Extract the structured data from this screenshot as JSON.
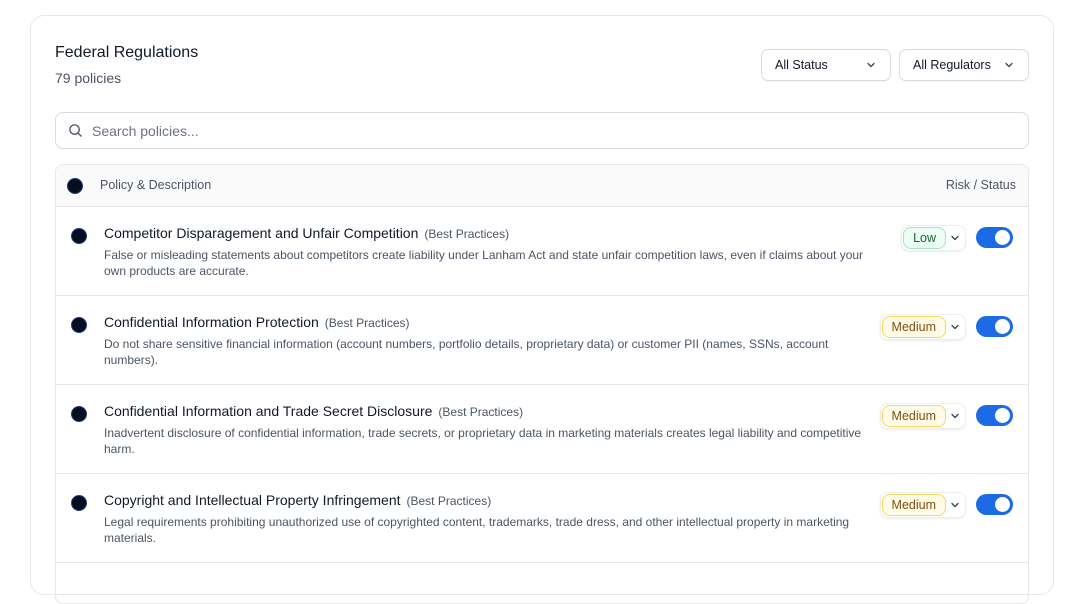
{
  "header": {
    "title": "Federal Regulations",
    "count": "79 policies"
  },
  "filters": {
    "status": "All Status",
    "regulators": "All Regulators"
  },
  "search": {
    "placeholder": "Search policies..."
  },
  "table": {
    "col_left": "Policy & Description",
    "col_right": "Risk / Status",
    "rows": [
      {
        "title": "Competitor Disparagement and Unfair Competition",
        "category": "(Best Practices)",
        "description": "False or misleading statements about competitors create liability under Lanham Act and state unfair competition laws, even if claims about your own products are accurate.",
        "risk": "Low",
        "enabled": true
      },
      {
        "title": "Confidential Information Protection",
        "category": "(Best Practices)",
        "description": "Do not share sensitive financial information (account numbers, portfolio details, proprietary data) or customer PII (names, SSNs, account numbers).",
        "risk": "Medium",
        "enabled": true
      },
      {
        "title": "Confidential Information and Trade Secret Disclosure",
        "category": "(Best Practices)",
        "description": "Inadvertent disclosure of confidential information, trade secrets, or proprietary data in marketing materials creates legal liability and competitive harm.",
        "risk": "Medium",
        "enabled": true
      },
      {
        "title": "Copyright and Intellectual Property Infringement",
        "category": "(Best Practices)",
        "description": "Legal requirements prohibiting unauthorized use of copyrighted content, trademarks, trade dress, and other intellectual property in marketing materials.",
        "risk": "Medium",
        "enabled": true
      }
    ]
  },
  "colors": {
    "toggle_on": "#1d6ae5",
    "low_bg": "#ecfdf3",
    "low_text": "#166534",
    "medium_bg": "#fefce8",
    "medium_text": "#854d0e"
  },
  "icons": {
    "search": "search-icon",
    "chevron": "chevron-down-icon"
  }
}
